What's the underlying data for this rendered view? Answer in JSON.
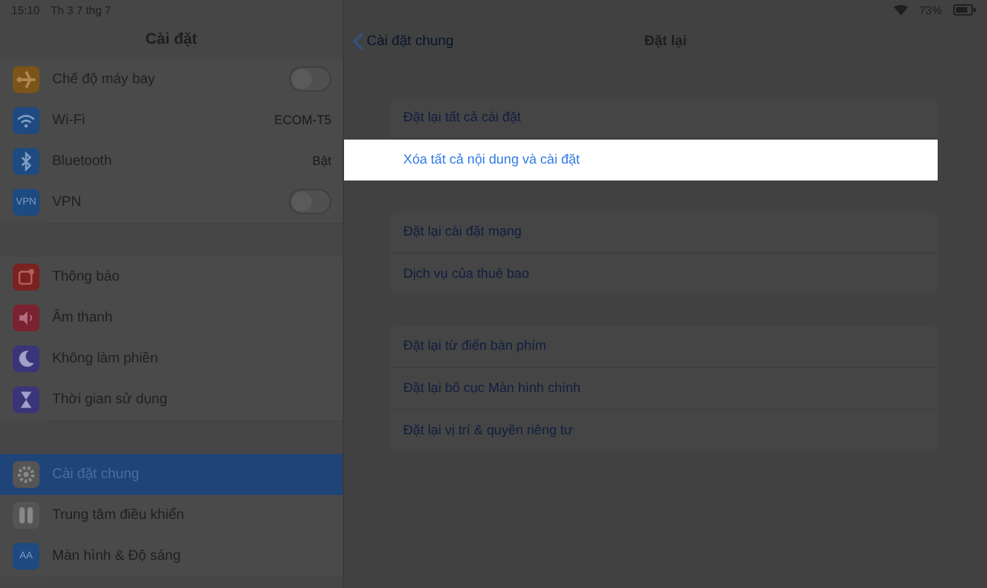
{
  "status_bar": {
    "time": "15:10",
    "date": "Th 3 7 thg 7",
    "battery_text": "73%"
  },
  "sidebar": {
    "title": "Cài đặt",
    "groups": [
      [
        {
          "label": "Chế độ máy bay",
          "kind": "toggle",
          "on": false,
          "selected": false
        },
        {
          "label": "Wi-Fi",
          "kind": "value",
          "value": "ECOM-T5",
          "selected": false
        },
        {
          "label": "Bluetooth",
          "kind": "value",
          "value": "Bật",
          "selected": false
        },
        {
          "label": "VPN",
          "icon_text": "VPN",
          "kind": "toggle",
          "on": false,
          "selected": false
        }
      ],
      [
        {
          "label": "Thông báo",
          "kind": "plain",
          "selected": false
        },
        {
          "label": "Âm thanh",
          "kind": "plain",
          "selected": false
        },
        {
          "label": "Không làm phiền",
          "kind": "plain",
          "selected": false
        },
        {
          "label": "Thời gian sử dụng",
          "kind": "plain",
          "selected": false
        }
      ],
      [
        {
          "label": "Cài đặt chung",
          "kind": "plain",
          "selected": true
        },
        {
          "label": "Trung tâm điều khiển",
          "kind": "plain",
          "selected": false
        },
        {
          "label": "Màn hình & Độ sáng",
          "icon_text": "AA",
          "kind": "plain",
          "selected": false
        }
      ]
    ]
  },
  "detail": {
    "back_label": "Cài đặt chung",
    "title": "Đặt lại",
    "groups": [
      [
        {
          "label": "Đặt lại tất cả cài đặt",
          "highlighted": false
        },
        {
          "label": "Xóa tất cả nội dung và cài đặt",
          "highlighted": true
        }
      ],
      [
        {
          "label": "Đặt lại cài đặt mạng",
          "highlighted": false
        },
        {
          "label": "Dịch vụ của thuê bao",
          "highlighted": false
        }
      ],
      [
        {
          "label": "Đặt lại từ điển bàn phím",
          "highlighted": false
        },
        {
          "label": "Đặt lại bố cục Màn hình chính",
          "highlighted": false
        },
        {
          "label": "Đặt lại vị trí & quyền riêng tư",
          "highlighted": false
        }
      ]
    ]
  }
}
